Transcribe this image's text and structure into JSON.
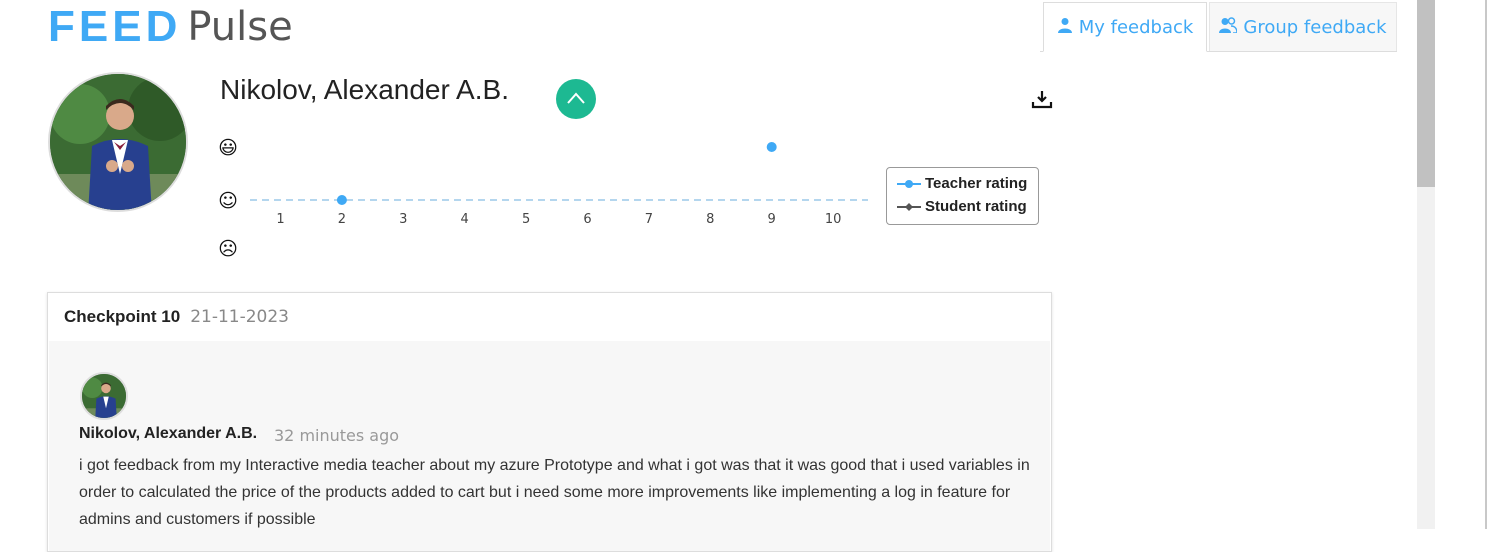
{
  "header": {
    "logo_feed": "FEED",
    "logo_pulse": "Pulse",
    "tabs": [
      {
        "label": "My feedback",
        "icon": "user-icon",
        "active": true
      },
      {
        "label": "Group feedback",
        "icon": "group-icon",
        "active": false
      }
    ]
  },
  "student": {
    "name": "Nikolov, Alexander A.B.",
    "collapse_icon": "chevron-up-icon",
    "download_icon": "download-icon"
  },
  "chart_data": {
    "type": "line",
    "x": [
      1,
      2,
      3,
      4,
      5,
      6,
      7,
      8,
      9,
      10
    ],
    "x_tick_labels": [
      "1",
      "2",
      "3",
      "4",
      "5",
      "6",
      "7",
      "8",
      "9",
      "10"
    ],
    "y_levels": [
      "happy",
      "neutral",
      "sad"
    ],
    "y_icons": [
      "😃",
      "☺",
      "☹"
    ],
    "series": [
      {
        "name": "Teacher rating",
        "color": "#3fa9f5",
        "points": [
          {
            "x": 2,
            "y": "neutral"
          },
          {
            "x": 9,
            "y": "happy"
          }
        ]
      },
      {
        "name": "Student rating",
        "color": "#555555",
        "points": []
      }
    ],
    "legend_position": "right"
  },
  "checkpoint": {
    "title": "Checkpoint 10",
    "date": "21-11-2023"
  },
  "comment": {
    "author": "Nikolov, Alexander A.B.",
    "time": "32 minutes ago",
    "text": "i got feedback from my Interactive media teacher about my azure Prototype and what i got was that it was good that i used variables in order to calculated the price of the products added to cart but i need some more improvements like implementing a log in feature for admins and customers if possible"
  }
}
